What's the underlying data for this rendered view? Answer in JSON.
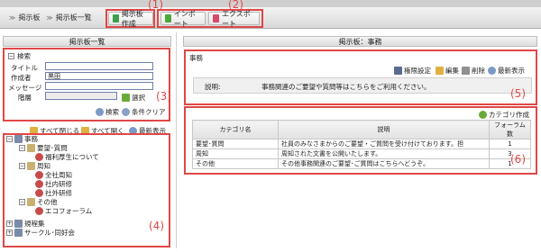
{
  "breadcrumb": [
    "掲示板",
    "掲示板一覧"
  ],
  "toolbar": {
    "create_label": "掲示板作成",
    "import_label": "インポート",
    "export_label": "エクスポート"
  },
  "annotations": [
    "(1)",
    "(2)",
    "(3)",
    "(4)",
    "(5)",
    "(6)"
  ],
  "left_panel": {
    "title": "掲示板一覧",
    "search": {
      "section_label": "検索",
      "title_label": "タイトル",
      "title_value": "",
      "author_label": "作成者",
      "author_value": "黒田",
      "message_label": "メッセージ",
      "message_value": "",
      "level_label": "階層",
      "level_value": "",
      "select_label": "選択",
      "search_label": "検索",
      "clear_label": "条件クリア"
    },
    "tree_tools": {
      "collapse_label": "すべて閉じる",
      "expand_label": "すべて開く",
      "refresh_label": "最新表示"
    },
    "tree": {
      "root": "事務",
      "cat1": "要望･質問",
      "cat1_item1": "福利厚生について",
      "cat2": "周知",
      "cat2_item1": "全社周知",
      "cat2_item2": "社内研修",
      "cat2_item3": "社外研修",
      "cat3": "その他",
      "cat3_item1": "エコフォーラム",
      "root2": "規程集",
      "root3": "サークル･同好会"
    }
  },
  "right_panel": {
    "title": "掲示板：事務",
    "board": {
      "name": "事務",
      "perm_label": "権限設定",
      "edit_label": "編集",
      "delete_label": "削除",
      "refresh_label": "最新表示",
      "desc_label": "説明:",
      "desc_value": "事務関連のご要望や質問等はこちらをご利用ください。"
    },
    "categories": {
      "create_label": "カテゴリ作成",
      "headers": [
        "カテゴリ名",
        "説明",
        "フォーラム数"
      ],
      "rows": [
        {
          "name": "要望･質問",
          "desc": "社員のみなさまからのご要望・ご質問を受け付けております。担",
          "count": "1"
        },
        {
          "name": "周知",
          "desc": "周知された文書を公開いたします。",
          "count": "3"
        },
        {
          "name": "その他",
          "desc": "その他事務関連のご要望･ご質問はこちらへどうぞ。",
          "count": "1"
        }
      ]
    }
  },
  "colors": {
    "annotation": "#e04848",
    "input_border": "#6e7fa8"
  }
}
